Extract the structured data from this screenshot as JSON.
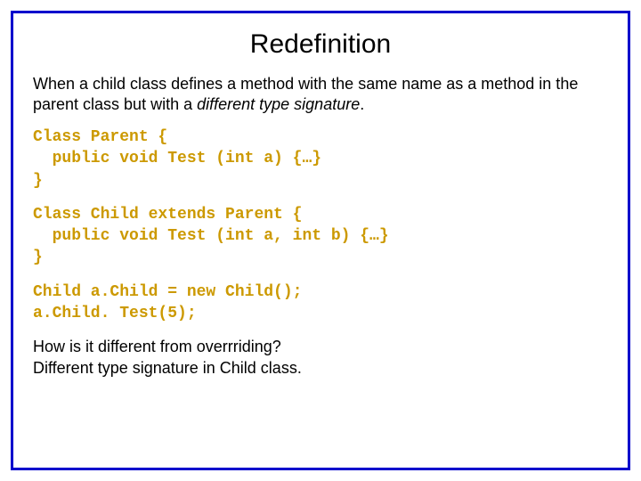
{
  "title": "Redefinition",
  "intro_part1": "When a child class defines a method with the same name as a method in the parent class but with a ",
  "intro_italic": "different type signature",
  "intro_part2": ".",
  "code_parent": "Class Parent {\n  public void Test (int a) {…}\n}",
  "code_child": "Class Child extends Parent {\n  public void Test (int a, int b) {…}\n}",
  "code_usage": "Child a.Child = new Child();\na.Child. Test(5);",
  "question": "How is it different from overrriding?",
  "answer": "Different type signature in Child class."
}
